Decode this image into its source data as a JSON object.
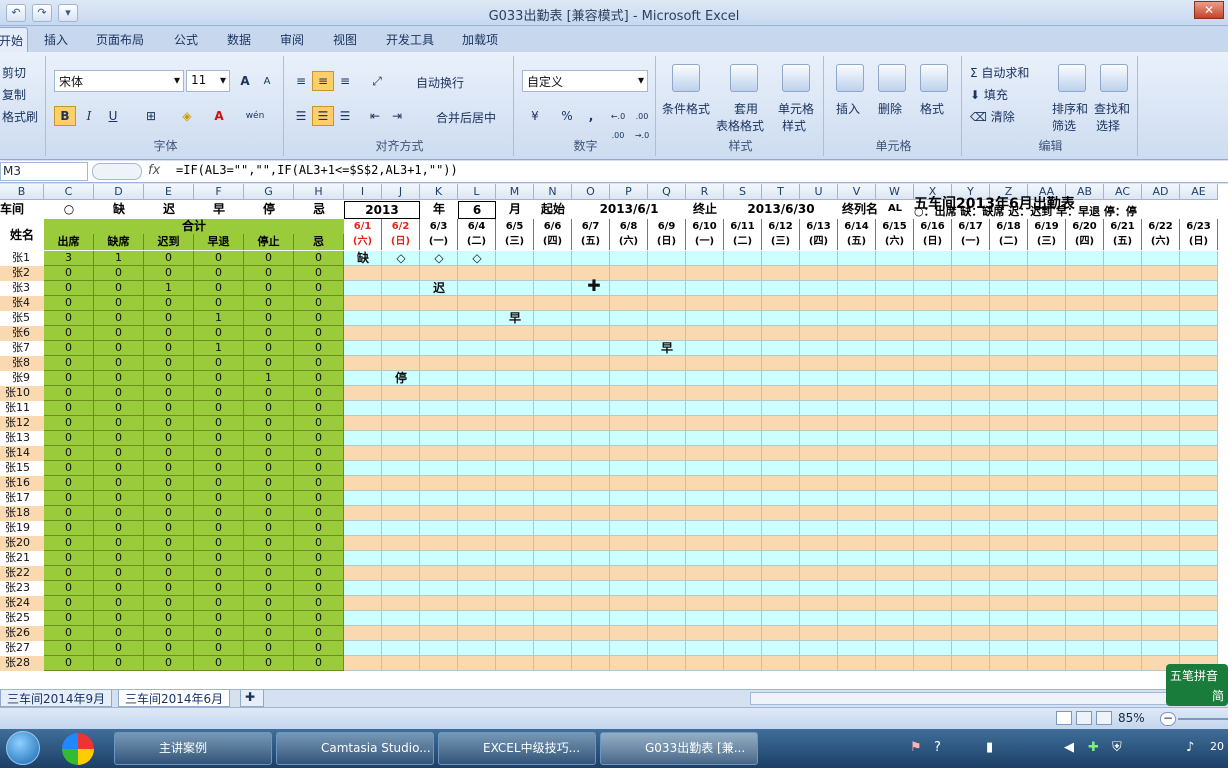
{
  "window": {
    "title": "G033出勤表  [兼容模式]  -  Microsoft Excel"
  },
  "tabs": [
    "开始",
    "插入",
    "页面布局",
    "公式",
    "数据",
    "审阅",
    "视图",
    "开发工具",
    "加载项"
  ],
  "ribbon": {
    "clipboard": {
      "cut": "剪切",
      "copy": "复制",
      "format_painter": "格式刷"
    },
    "font": {
      "name": "宋体",
      "size": "11",
      "label": "字体",
      "grow": "A",
      "shrink": "A",
      "bold": "B",
      "italic": "I",
      "underline": "U",
      "phonetic": "wén"
    },
    "alignment": {
      "wrap": "自动换行",
      "merge": "合并后居中",
      "label": "对齐方式"
    },
    "number": {
      "format": "自定义",
      "percent": "%",
      "comma": ",",
      "inc": "←.0 .00",
      "dec": ".00 →.0",
      "label": "数字"
    },
    "styles": {
      "conditional": "条件格式",
      "table_1": "套用",
      "table_2": "表格格式",
      "cell_1": "单元格",
      "cell_2": "样式",
      "label": "样式"
    },
    "cells": {
      "insert": "插入",
      "delete": "删除",
      "format": "格式",
      "label": "单元格"
    },
    "editing": {
      "autosum": "自动求和",
      "fill": "填充",
      "clear": "清除",
      "sort_1": "排序和",
      "sort_2": "筛选",
      "find_1": "查找和",
      "find_2": "选择",
      "label": "编辑"
    }
  },
  "formula_bar": {
    "name_box": "M3",
    "fx": "fx",
    "formula": "=IF(AL3=\"\",\"\",IF(AL3+1<=$S$2,AL3+1,\"\"))"
  },
  "columns": [
    "B",
    "C",
    "D",
    "E",
    "F",
    "G",
    "H",
    "I",
    "J",
    "K",
    "L",
    "M",
    "N",
    "O",
    "P",
    "Q",
    "R",
    "S",
    "T",
    "U",
    "V",
    "W",
    "X",
    "Y",
    "Z",
    "AA",
    "AB",
    "AC",
    "AD",
    "AE"
  ],
  "sheet": {
    "row1": {
      "b": "车间",
      "c": "○",
      "d": "缺",
      "e": "迟",
      "f": "早",
      "g": "停",
      "h": "忌"
    },
    "header_year": "2013",
    "header_nian": "年",
    "header_month": "6",
    "header_yue": "月",
    "start_label": "起始",
    "start_value": "2013/6/1",
    "end_label": "终止",
    "end_value": "2013/6/30",
    "last_col_label": "终列名",
    "last_col_value": "AL",
    "title": "五车间2013年6月出勤表",
    "legend": "○：出席  缺：缺席  迟：迟到  早：早退  停：停",
    "name_header": "姓名",
    "total_header": "合计",
    "sub_headers": [
      "出席",
      "缺席",
      "迟到",
      "早退",
      "停止",
      "忌"
    ],
    "dates": [
      "6/1",
      "6/2",
      "6/3",
      "6/4",
      "6/5",
      "6/6",
      "6/7",
      "6/8",
      "6/9",
      "6/10",
      "6/11",
      "6/12",
      "6/13",
      "6/14",
      "6/15",
      "6/16",
      "6/17",
      "6/18",
      "6/19",
      "6/20",
      "6/21",
      "6/22",
      "6/23"
    ],
    "weekdays": [
      "(六)",
      "(日)",
      "(一)",
      "(二)",
      "(三)",
      "(四)",
      "(五)",
      "(六)",
      "(日)",
      "(一)",
      "(二)",
      "(三)",
      "(四)",
      "(五)",
      "(六)",
      "(日)",
      "(一)",
      "(二)",
      "(三)",
      "(四)",
      "(五)",
      "(六)",
      "(日)"
    ],
    "rows": [
      {
        "name": "张1",
        "v": [
          3,
          1,
          0,
          0,
          0,
          0
        ]
      },
      {
        "name": "张2",
        "v": [
          0,
          0,
          0,
          0,
          0,
          0
        ]
      },
      {
        "name": "张3",
        "v": [
          0,
          0,
          1,
          0,
          0,
          0
        ]
      },
      {
        "name": "张4",
        "v": [
          0,
          0,
          0,
          0,
          0,
          0
        ]
      },
      {
        "name": "张5",
        "v": [
          0,
          0,
          0,
          1,
          0,
          0
        ]
      },
      {
        "name": "张6",
        "v": [
          0,
          0,
          0,
          0,
          0,
          0
        ]
      },
      {
        "name": "张7",
        "v": [
          0,
          0,
          0,
          1,
          0,
          0
        ]
      },
      {
        "name": "张8",
        "v": [
          0,
          0,
          0,
          0,
          0,
          0
        ]
      },
      {
        "name": "张9",
        "v": [
          0,
          0,
          0,
          0,
          1,
          0
        ]
      },
      {
        "name": "张10",
        "v": [
          0,
          0,
          0,
          0,
          0,
          0
        ]
      },
      {
        "name": "张11",
        "v": [
          0,
          0,
          0,
          0,
          0,
          0
        ]
      },
      {
        "name": "张12",
        "v": [
          0,
          0,
          0,
          0,
          0,
          0
        ]
      },
      {
        "name": "张13",
        "v": [
          0,
          0,
          0,
          0,
          0,
          0
        ]
      },
      {
        "name": "张14",
        "v": [
          0,
          0,
          0,
          0,
          0,
          0
        ]
      },
      {
        "name": "张15",
        "v": [
          0,
          0,
          0,
          0,
          0,
          0
        ]
      },
      {
        "name": "张16",
        "v": [
          0,
          0,
          0,
          0,
          0,
          0
        ]
      },
      {
        "name": "张17",
        "v": [
          0,
          0,
          0,
          0,
          0,
          0
        ]
      },
      {
        "name": "张18",
        "v": [
          0,
          0,
          0,
          0,
          0,
          0
        ]
      },
      {
        "name": "张19",
        "v": [
          0,
          0,
          0,
          0,
          0,
          0
        ]
      },
      {
        "name": "张20",
        "v": [
          0,
          0,
          0,
          0,
          0,
          0
        ]
      },
      {
        "name": "张21",
        "v": [
          0,
          0,
          0,
          0,
          0,
          0
        ]
      },
      {
        "name": "张22",
        "v": [
          0,
          0,
          0,
          0,
          0,
          0
        ]
      },
      {
        "name": "张23",
        "v": [
          0,
          0,
          0,
          0,
          0,
          0
        ]
      },
      {
        "name": "张24",
        "v": [
          0,
          0,
          0,
          0,
          0,
          0
        ]
      },
      {
        "name": "张25",
        "v": [
          0,
          0,
          0,
          0,
          0,
          0
        ]
      },
      {
        "name": "张26",
        "v": [
          0,
          0,
          0,
          0,
          0,
          0
        ]
      },
      {
        "name": "张27",
        "v": [
          0,
          0,
          0,
          0,
          0,
          0
        ]
      },
      {
        "name": "张28",
        "v": [
          0,
          0,
          0,
          0,
          0,
          0
        ]
      }
    ],
    "marks": [
      {
        "row": 0,
        "day": 0,
        "text": "缺"
      },
      {
        "row": 0,
        "day": 1,
        "text": "◇"
      },
      {
        "row": 0,
        "day": 2,
        "text": "◇"
      },
      {
        "row": 0,
        "day": 3,
        "text": "◇"
      },
      {
        "row": 2,
        "day": 2,
        "text": "迟"
      },
      {
        "row": 4,
        "day": 4,
        "text": "早"
      },
      {
        "row": 6,
        "day": 8,
        "text": "早"
      },
      {
        "row": 8,
        "day": 1,
        "text": "停"
      }
    ]
  },
  "sheet_tabs": [
    "三车间2014年9月",
    "三车间2014年6月"
  ],
  "status": {
    "zoom": "85%"
  },
  "ime": {
    "line1": "五笔拼音",
    "line2": "简"
  },
  "taskbar": {
    "items": [
      "主讲案例",
      "Camtasia Studio...",
      "EXCEL中级技巧...",
      "G033出勤表  [兼..."
    ],
    "clock": "20"
  },
  "colors": {
    "green": "#9acb3b",
    "orange": "#fad9b0",
    "cyan": "#ccffff",
    "red": "#e0271a"
  }
}
